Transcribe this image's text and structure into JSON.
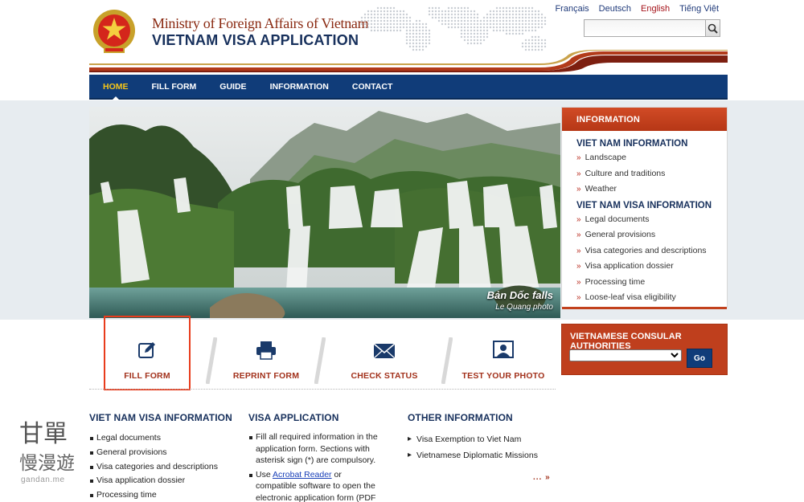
{
  "header": {
    "ministry": "Ministry of Foreign Affairs of Vietnam",
    "app_title": "VIETNAM VISA APPLICATION",
    "languages": [
      "Français",
      "Deutsch",
      "English",
      "Tiếng Việt"
    ],
    "active_language": "English",
    "search": {
      "value": "",
      "placeholder": ""
    }
  },
  "nav": {
    "items": [
      "HOME",
      "FILL FORM",
      "GUIDE",
      "INFORMATION",
      "CONTACT"
    ],
    "active": "HOME"
  },
  "hero": {
    "caption_title": "Bản Dốc falls",
    "caption_credit": "Le Quang photo"
  },
  "info_panel": {
    "title": "INFORMATION",
    "section1_title": "VIET NAM INFORMATION",
    "section1_items": [
      "Landscape",
      "Culture and traditions",
      "Weather"
    ],
    "section2_title": "VIET NAM VISA INFORMATION",
    "section2_items": [
      "Legal documents",
      "General provisions",
      "Visa categories and descriptions",
      "Visa application dossier",
      "Processing time",
      "Loose-leaf visa eligibility"
    ]
  },
  "consular": {
    "title": "VIETNAMESE CONSULAR AUTHORITIES",
    "selected": "",
    "go_label": "Go"
  },
  "actions": [
    {
      "label": "FILL FORM",
      "icon": "edit-icon"
    },
    {
      "label": "REPRINT FORM",
      "icon": "printer-icon"
    },
    {
      "label": "CHECK STATUS",
      "icon": "envelope-icon"
    },
    {
      "label": "TEST YOUR PHOTO",
      "icon": "portrait-icon"
    }
  ],
  "col_visa_info": {
    "title": "VIET NAM VISA INFORMATION",
    "items": [
      "Legal documents",
      "General provisions",
      "Visa categories and descriptions",
      "Visa application dossier",
      "Processing time"
    ]
  },
  "col_visa_app": {
    "title": "VISA APPLICATION",
    "para1": "Fill all required information in the application form. Sections with asterisk sign (*) are compulsory.",
    "para2_pre": "Use ",
    "para2_link": "Acrobat Reader",
    "para2_post": " or compatible software to open the electronic application form (PDF format)."
  },
  "col_other": {
    "title": "OTHER INFORMATION",
    "items": [
      "Visa Exemption to Viet Nam",
      "Vietnamese Diplomatic Missions"
    ],
    "more": "... »"
  },
  "watermark": {
    "line1": "甘單",
    "line2": "慢漫遊",
    "site": "gandan.me"
  },
  "colors": {
    "navy": "#103c79",
    "brand_red": "#bf3f1d",
    "title_red": "#8a2a12",
    "active_nav": "#f5c518"
  }
}
